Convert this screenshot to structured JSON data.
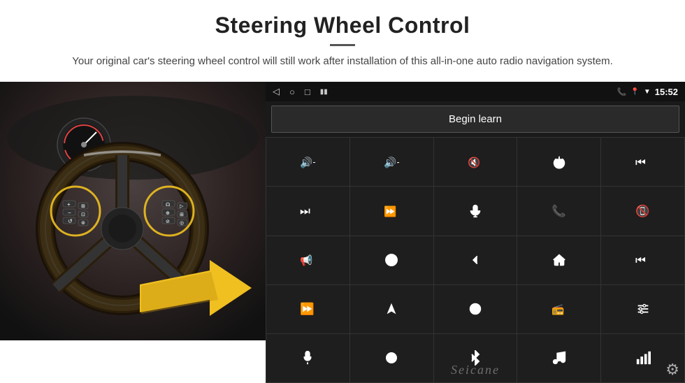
{
  "page": {
    "title": "Steering Wheel Control",
    "subtitle": "Your original car's steering wheel control will still work after installation of this all-in-one auto radio navigation system.",
    "divider_visible": true
  },
  "status_bar": {
    "time": "15:52",
    "nav_back": "◁",
    "nav_home": "○",
    "nav_square": "□",
    "signal_icon": "📶",
    "phone_icon": "📞",
    "location_icon": "📍",
    "wifi_icon": "▼"
  },
  "begin_learn_button": {
    "label": "Begin learn"
  },
  "controls": {
    "rows": [
      [
        "vol+",
        "vol-",
        "mute",
        "power",
        "prev-track"
      ],
      [
        "next",
        "skip-fwd",
        "mic",
        "phone",
        "hang-up"
      ],
      [
        "horn",
        "360",
        "back",
        "home",
        "prev"
      ],
      [
        "fast-fwd",
        "nav",
        "source",
        "radio",
        "eq"
      ],
      [
        "mic2",
        "knob",
        "bluetooth",
        "music",
        "bars"
      ]
    ]
  },
  "watermark": {
    "text": "Seicane"
  },
  "icons": {
    "gear": "⚙"
  }
}
